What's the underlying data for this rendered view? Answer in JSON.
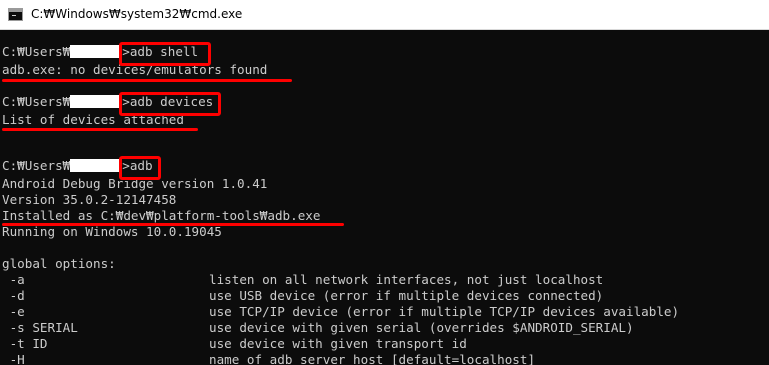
{
  "window": {
    "title": "C:₩Windows₩system32₩cmd.exe",
    "icon": "terminal-icon"
  },
  "colors": {
    "console_bg": "#0c0c0c",
    "console_text": "#cccccc",
    "highlight": "#ff0000",
    "title_bg": "#ffffff"
  },
  "console": {
    "prompt_prefix": "C:₩Users₩",
    "prompt_suffix": ">",
    "cmd1": "adb shell",
    "error1": "adb.exe: no devices/emulators found",
    "cmd2": "adb devices",
    "devices_header": "List of devices attached",
    "cmd3": "adb",
    "version_line": "Android Debug Bridge version 1.0.41",
    "build_line": "Version 35.0.2-12147458",
    "installed_line": "Installed as C:₩dev₩platform-tools₩adb.exe",
    "running_line": "Running on Windows 10.0.19045",
    "global_options_header": "global options:",
    "options": [
      {
        "flag": " -a",
        "desc": "listen on all network interfaces, not just localhost"
      },
      {
        "flag": " -d",
        "desc": "use USB device (error if multiple devices connected)"
      },
      {
        "flag": " -e",
        "desc": "use TCP/IP device (error if multiple TCP/IP devices available)"
      },
      {
        "flag": " -s SERIAL",
        "desc": "use device with given serial (overrides $ANDROID_SERIAL)"
      },
      {
        "flag": " -t ID",
        "desc": "use device with given transport id"
      },
      {
        "flag": " -H",
        "desc": "name of adb server host [default=localhost]"
      }
    ]
  }
}
